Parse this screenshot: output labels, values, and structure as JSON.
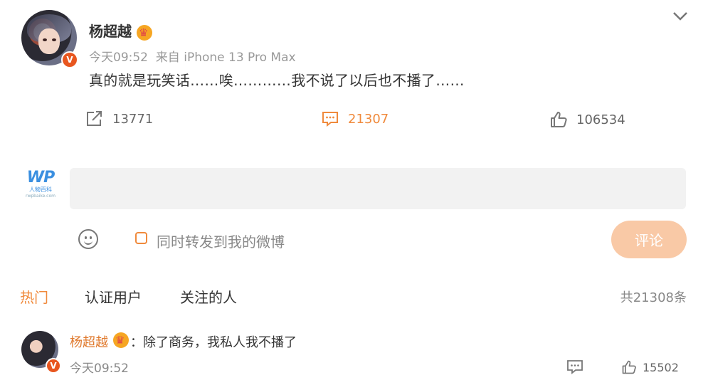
{
  "post": {
    "username": "杨超越",
    "time": "今天09:52",
    "source": "来自 iPhone 13 Pro Max",
    "text": "真的就是玩笑话……唉…………我不说了以后也不播了……",
    "verified_badge": "V"
  },
  "actions": {
    "repost_count": "13771",
    "comment_count": "21307",
    "like_count": "106534"
  },
  "comment_box": {
    "logo_text": "WP",
    "logo_sub": "人物百科",
    "logo_sub2": "rwpbaike.com",
    "placeholder": "",
    "repost_label": "同时转发到我的微博",
    "submit_label": "评论"
  },
  "tabs": [
    {
      "label": "热门",
      "active": true
    },
    {
      "label": "认证用户",
      "active": false
    },
    {
      "label": "关注的人",
      "active": false
    }
  ],
  "total_label": "共21308条",
  "comments": [
    {
      "username": "杨超越",
      "text": "：除了商务，我私人我不播了",
      "time": "今天09:52",
      "like_count": "15502"
    }
  ],
  "icons": [
    "chevron-down-icon",
    "repost-icon",
    "comment-icon",
    "like-icon",
    "emoji-icon",
    "crown-icon",
    "verified-icon"
  ],
  "colors": {
    "accent": "#f08a3c",
    "submit_bg": "#f9c9a6",
    "verified": "#e8561f"
  }
}
